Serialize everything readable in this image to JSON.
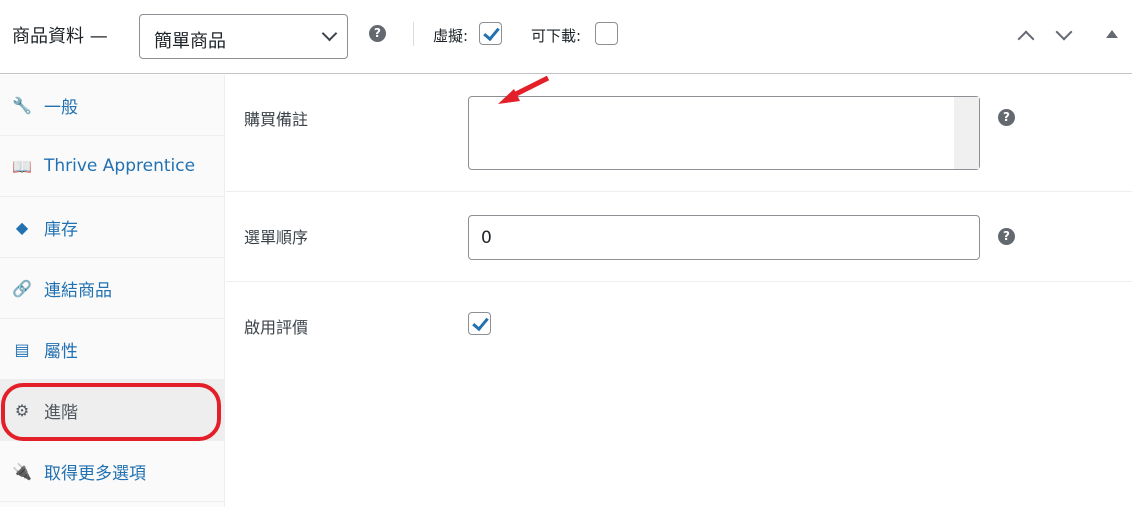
{
  "header": {
    "title": "商品資料 —",
    "product_type": "簡單商品",
    "virtual_label": "虛擬:",
    "virtual_checked": true,
    "downloadable_label": "可下載:",
    "downloadable_checked": false,
    "help": "?"
  },
  "sidebar": {
    "items": [
      {
        "label": "一般",
        "icon": "wrench-icon"
      },
      {
        "label": "Thrive Apprentice",
        "icon": "book-icon"
      },
      {
        "label": "庫存",
        "icon": "tag-icon"
      },
      {
        "label": "連結商品",
        "icon": "link-icon"
      },
      {
        "label": "屬性",
        "icon": "list-icon"
      },
      {
        "label": "進階",
        "icon": "gear-icon",
        "active": true
      },
      {
        "label": "取得更多選項",
        "icon": "plug-icon"
      }
    ]
  },
  "fields": {
    "purchase_note_label": "購買備註",
    "purchase_note_value": "",
    "menu_order_label": "選單順序",
    "menu_order_value": "0",
    "reviews_label": "啟用評價",
    "reviews_checked": true
  },
  "annotation_color": "#e3202a"
}
